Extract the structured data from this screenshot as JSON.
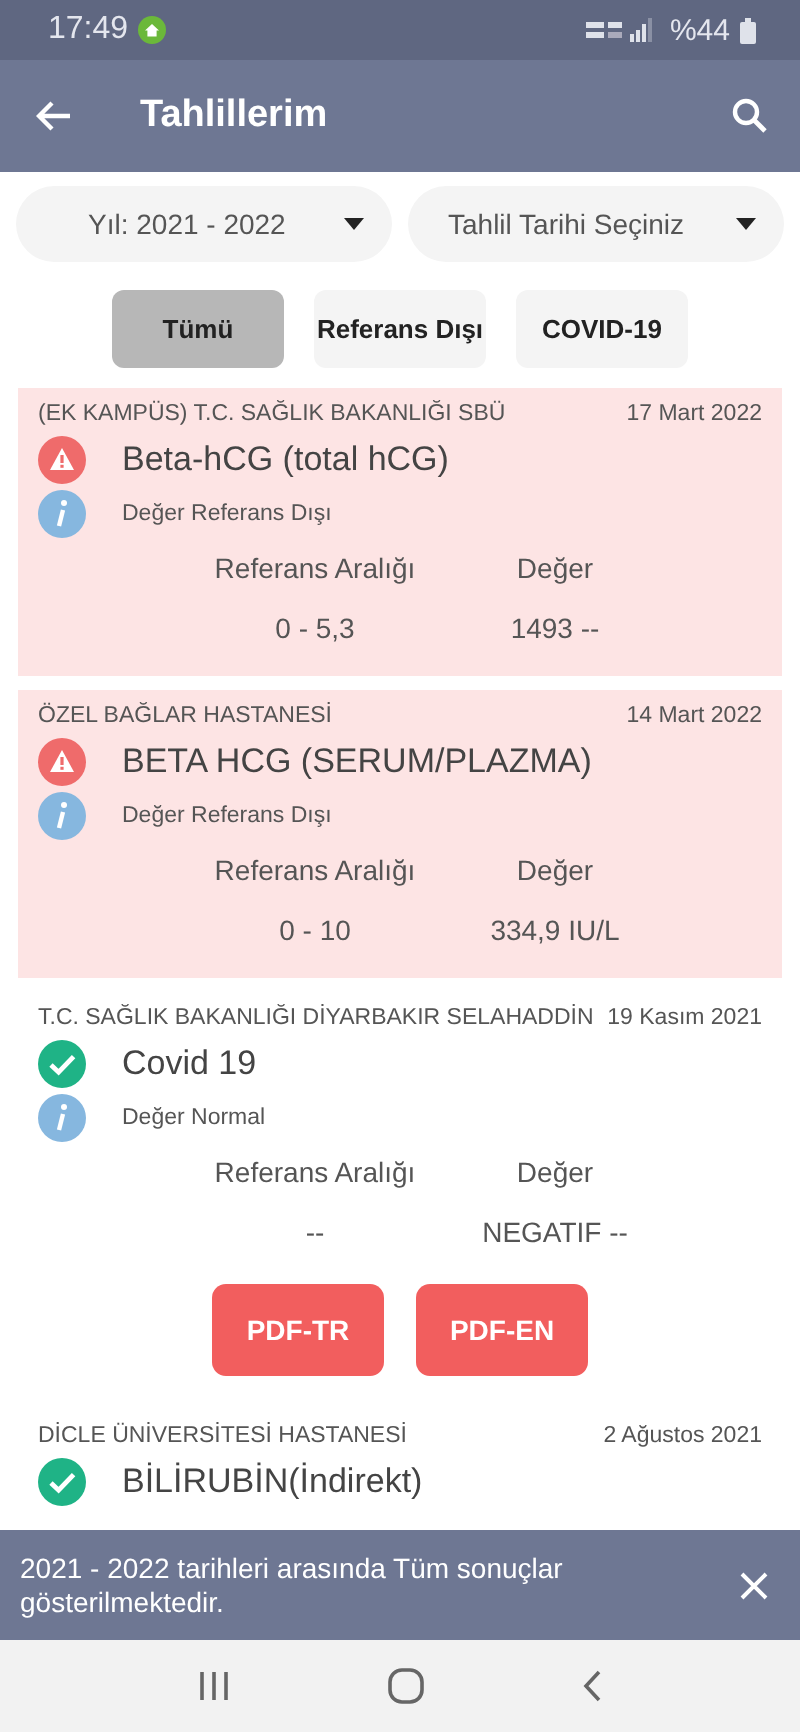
{
  "status_bar": {
    "time": "17:49",
    "battery": "%44"
  },
  "app_bar": {
    "title": "Tahlillerim"
  },
  "filters": [
    {
      "label": "Yıl: 2021 - 2022"
    },
    {
      "label": "Tahlil Tarihi Seçiniz"
    }
  ],
  "chips": [
    {
      "label": "Tümü",
      "selected": true
    },
    {
      "label": "Referans Dışı",
      "selected": false
    },
    {
      "label": "COVID-19",
      "selected": false
    }
  ],
  "results": [
    {
      "kind": "abnormal",
      "hospital": "(EK KAMPÜS) T.C. SAĞLIK BAKANLIĞI SBÜ",
      "date": "17 Mart 2022",
      "test": "Beta-hCG (total hCG)",
      "note": "Değer Referans Dışı",
      "range_label": "Referans Aralığı",
      "value_label": "Değer",
      "range": "0 - 5,3",
      "value": "1493 --"
    },
    {
      "kind": "abnormal",
      "hospital": "ÖZEL BAĞLAR HASTANESİ",
      "date": "14 Mart 2022",
      "test": "BETA HCG (SERUM/PLAZMA)",
      "note": "Değer Referans Dışı",
      "range_label": "Referans Aralığı",
      "value_label": "Değer",
      "range": "0 - 10",
      "value": "334,9 IU/L"
    },
    {
      "kind": "normal",
      "hospital": "T.C. SAĞLIK BAKANLIĞI DİYARBAKIR SELAHADDİN",
      "date": "19 Kasım 2021",
      "test": "Covid 19",
      "note": "Değer Normal",
      "range_label": "Referans Aralığı",
      "value_label": "Değer",
      "range": "--",
      "value": "NEGATIF --",
      "buttons": [
        "PDF-TR",
        "PDF-EN"
      ]
    },
    {
      "kind": "normal",
      "hospital": "DİCLE ÜNİVERSİTESİ HASTANESİ",
      "date": "2 Ağustos 2021",
      "test": "BİLİRUBİN(İndirekt)"
    }
  ],
  "snackbar": {
    "message": "2021 - 2022 tarihleri arasında Tüm sonuçlar gösterilmektedir."
  }
}
